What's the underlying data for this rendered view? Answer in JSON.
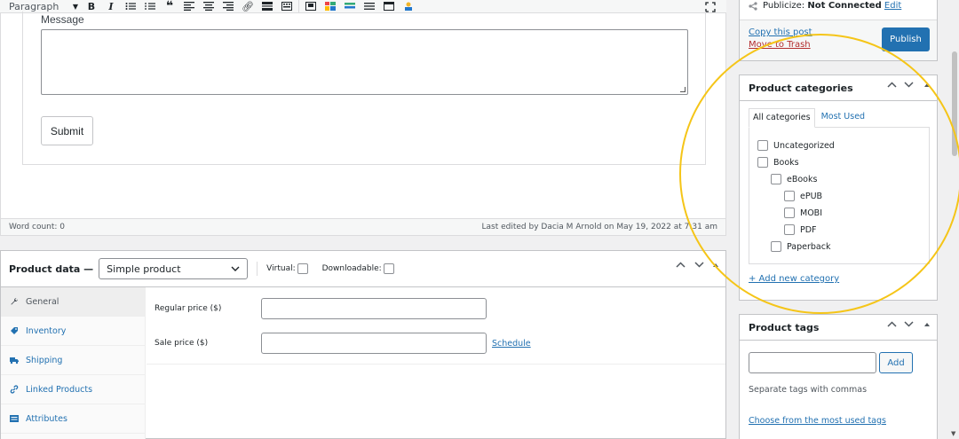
{
  "toolbar": {
    "format_value": "Paragraph",
    "buttons": [
      "B",
      "I"
    ]
  },
  "editor": {
    "message_label": "Message",
    "submit_label": "Submit"
  },
  "status": {
    "word_count": "Word count: 0",
    "last_edited": "Last edited by Dacia M Arnold on May 19, 2022 at 7:31 am"
  },
  "product_data": {
    "title": "Product data —",
    "type_value": "Simple product",
    "virtual_label": "Virtual:",
    "downloadable_label": "Downloadable:",
    "tabs": [
      {
        "label": "General",
        "icon": "wrench-icon"
      },
      {
        "label": "Inventory",
        "icon": "tag-icon"
      },
      {
        "label": "Shipping",
        "icon": "truck-icon"
      },
      {
        "label": "Linked Products",
        "icon": "link-icon"
      },
      {
        "label": "Attributes",
        "icon": "list-icon"
      }
    ],
    "regular_price_label": "Regular price ($)",
    "sale_price_label": "Sale price ($)",
    "schedule_label": "Schedule"
  },
  "publish": {
    "publicize_label": "Publicize:",
    "publicize_status": "Not Connected",
    "edit_label": "Edit",
    "copy_label": "Copy this post",
    "trash_label": "Move to Trash",
    "publish_label": "Publish"
  },
  "categories": {
    "title": "Product categories",
    "tab_all": "All categories",
    "tab_most_used": "Most Used",
    "items": [
      {
        "label": "Uncategorized",
        "level": 0
      },
      {
        "label": "Books",
        "level": 0
      },
      {
        "label": "eBooks",
        "level": 1
      },
      {
        "label": "ePUB",
        "level": 2
      },
      {
        "label": "MOBI",
        "level": 2
      },
      {
        "label": "PDF",
        "level": 2
      },
      {
        "label": "Paperback",
        "level": 1
      }
    ],
    "add_new": "+ Add new category"
  },
  "tags": {
    "title": "Product tags",
    "add_label": "Add",
    "hint": "Separate tags with commas",
    "choose": "Choose from the most used tags"
  },
  "colors": {
    "accent": "#2271b1",
    "highlight": "#f5c518",
    "danger": "#b32d2e"
  }
}
